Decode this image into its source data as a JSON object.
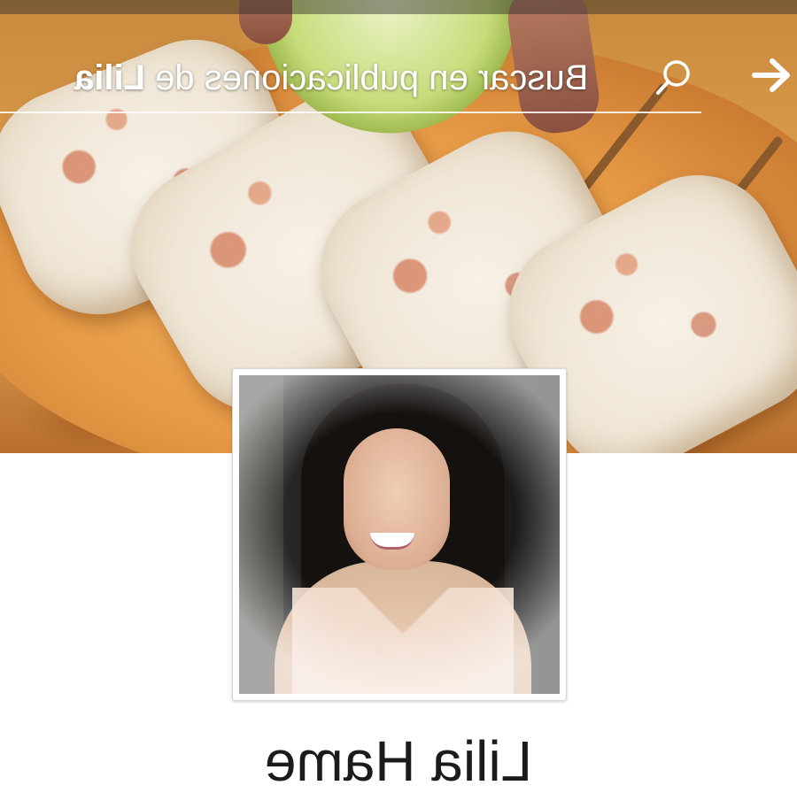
{
  "search": {
    "prefix": "Buscar en publicaciones de ",
    "name_bold": "Lilia"
  },
  "profile": {
    "name": "Lilia Hame"
  },
  "icons": {
    "search": "search-icon",
    "back": "arrow-right-icon"
  },
  "colors": {
    "search_text": "#ffffff",
    "name_text": "#1b1b1b"
  }
}
